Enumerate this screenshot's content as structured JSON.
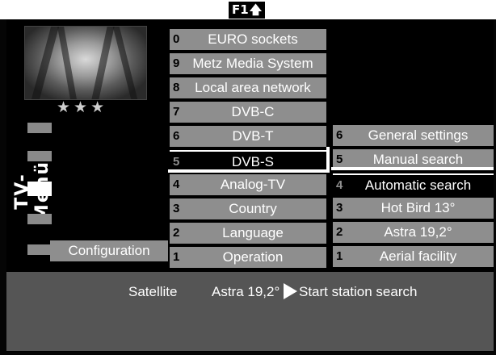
{
  "header": {
    "key_label": "F1",
    "key_icon": "arrow-up-icon"
  },
  "panel": {
    "title": "TV-Menü",
    "rating": "★★★",
    "selected_label": "Configuration"
  },
  "menu": [
    {
      "num": "0",
      "label": "EURO sockets"
    },
    {
      "num": "9",
      "label": "Metz Media System"
    },
    {
      "num": "8",
      "label": "Local area network"
    },
    {
      "num": "7",
      "label": "DVB-C"
    },
    {
      "num": "6",
      "label": "DVB-T"
    },
    {
      "num": "5",
      "label": "DVB-S",
      "selected": true
    },
    {
      "num": "4",
      "label": "Analog-TV"
    },
    {
      "num": "3",
      "label": "Country"
    },
    {
      "num": "2",
      "label": "Language"
    },
    {
      "num": "1",
      "label": "Operation"
    }
  ],
  "submenu": [
    {
      "num": "6",
      "label": "General settings"
    },
    {
      "num": "5",
      "label": "Manual search"
    },
    {
      "num": "4",
      "label": "Automatic search",
      "selected": true
    },
    {
      "num": "3",
      "label": "Hot Bird 13°"
    },
    {
      "num": "2",
      "label": "Astra 19,2°"
    },
    {
      "num": "1",
      "label": "Aerial facility"
    }
  ],
  "status": {
    "label": "Satellite",
    "value": "Astra 19,2°",
    "action": "Start station search"
  }
}
